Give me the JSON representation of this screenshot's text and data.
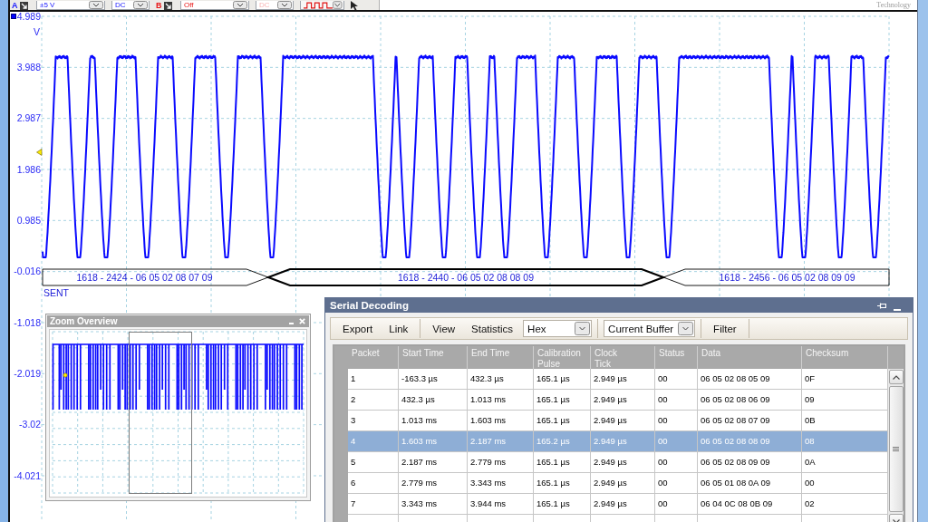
{
  "top_toolbar": {
    "channels": [
      {
        "label": "A",
        "color": "#2020ff",
        "range": "±5 V",
        "coupling": "DC",
        "coupling_disabled": false
      },
      {
        "label": "B",
        "color": "#e81818",
        "range": "Off",
        "coupling": "DC",
        "coupling_disabled": true
      }
    ],
    "logo_text": "Technology"
  },
  "scope": {
    "y_axis": {
      "labels": [
        "4.989",
        "3.988",
        "2.987",
        "1.986",
        "0.985",
        "-0.016",
        "-1.018",
        "-2.019",
        "-3.02",
        "-4.021"
      ],
      "unit": "V"
    },
    "decode_frames": [
      {
        "text": "1618 - 2424 - 06 05 02 08 07 09",
        "selected": false
      },
      {
        "text": "1618 - 2440 - 06 05 02 08 08 09",
        "selected": true
      },
      {
        "text": "1618 - 2456 - 06 05 02 08 09 09",
        "selected": false
      }
    ],
    "channel_label": "SENT"
  },
  "zoom_overview": {
    "title": "Zoom Overview"
  },
  "serial_decoding": {
    "title": "Serial Decoding",
    "toolbar": {
      "groups": [
        [
          {
            "kind": "button",
            "label": "Export"
          },
          {
            "kind": "button",
            "label": "Link"
          }
        ],
        [
          {
            "kind": "button",
            "label": "View"
          },
          {
            "kind": "button",
            "label": "Statistics"
          },
          {
            "kind": "dropdown",
            "value": "Hex"
          }
        ],
        [
          {
            "kind": "dropdown",
            "value": "Current Buffer"
          }
        ],
        [
          {
            "kind": "button",
            "label": "Filter"
          }
        ]
      ]
    },
    "table": {
      "columns": [
        "Packet",
        "Start Time",
        "End Time",
        "Calibration\nPulse",
        "Clock\nTick",
        "Status",
        "Data",
        "Checksum"
      ],
      "rows": [
        {
          "cells": [
            "1",
            "-163.3 µs",
            "432.3 µs",
            "165.1 µs",
            "2.949 µs",
            "00",
            "06 05 02 08 05 09",
            "0F"
          ],
          "selected": false
        },
        {
          "cells": [
            "2",
            "432.3 µs",
            "1.013 ms",
            "165.1 µs",
            "2.949 µs",
            "00",
            "06 05 02 08 06 09",
            "09"
          ],
          "selected": false
        },
        {
          "cells": [
            "3",
            "1.013 ms",
            "1.603 ms",
            "165.1 µs",
            "2.949 µs",
            "00",
            "06 05 02 08 07 09",
            "0B"
          ],
          "selected": false
        },
        {
          "cells": [
            "4",
            "1.603 ms",
            "2.187 ms",
            "165.2 µs",
            "2.949 µs",
            "00",
            "06 05 02 08 08 09",
            "08"
          ],
          "selected": true
        },
        {
          "cells": [
            "5",
            "2.187 ms",
            "2.779 ms",
            "165.1 µs",
            "2.949 µs",
            "00",
            "06 05 02 08 09 09",
            "0A"
          ],
          "selected": false
        },
        {
          "cells": [
            "6",
            "2.779 ms",
            "3.343 ms",
            "165.1 µs",
            "2.949 µs",
            "00",
            "06 05 01 08 0A 09",
            "00"
          ],
          "selected": false
        },
        {
          "cells": [
            "7",
            "3.343 ms",
            "3.944 ms",
            "165.1 µs",
            "2.949 µs",
            "00",
            "06 04 0C 08 0B 09",
            "02"
          ],
          "selected": false
        }
      ]
    }
  }
}
